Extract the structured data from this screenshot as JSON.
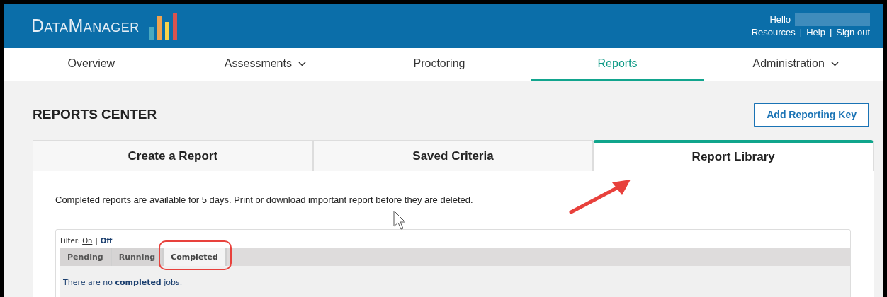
{
  "header": {
    "logo": "DataManager",
    "greeting": "Hello",
    "links": [
      "Resources",
      "Help",
      "Sign out"
    ],
    "separator": "|"
  },
  "nav": [
    {
      "label": "Overview",
      "dropdown": false,
      "selected": false
    },
    {
      "label": "Assessments",
      "dropdown": true,
      "selected": false
    },
    {
      "label": "Proctoring",
      "dropdown": false,
      "selected": false
    },
    {
      "label": "Reports",
      "dropdown": false,
      "selected": true
    },
    {
      "label": "Administration",
      "dropdown": true,
      "selected": false
    }
  ],
  "page_title": "REPORTS CENTER",
  "add_button": "Add Reporting Key",
  "tabs": [
    {
      "label": "Create a Report",
      "selected": false
    },
    {
      "label": "Saved Criteria",
      "selected": false
    },
    {
      "label": "Report Library",
      "selected": true
    }
  ],
  "notice": "Completed reports are available for 5 days. Print or download important report before they are deleted.",
  "filter": {
    "label": "Filter:",
    "separator": "|",
    "options": [
      {
        "label": "On",
        "selected": false
      },
      {
        "label": "Off",
        "selected": true
      }
    ]
  },
  "job_tabs": [
    {
      "label": "Pending",
      "selected": false
    },
    {
      "label": "Running",
      "selected": false
    },
    {
      "label": "Completed",
      "selected": true
    }
  ],
  "empty_message": "There are no **completed** jobs."
}
